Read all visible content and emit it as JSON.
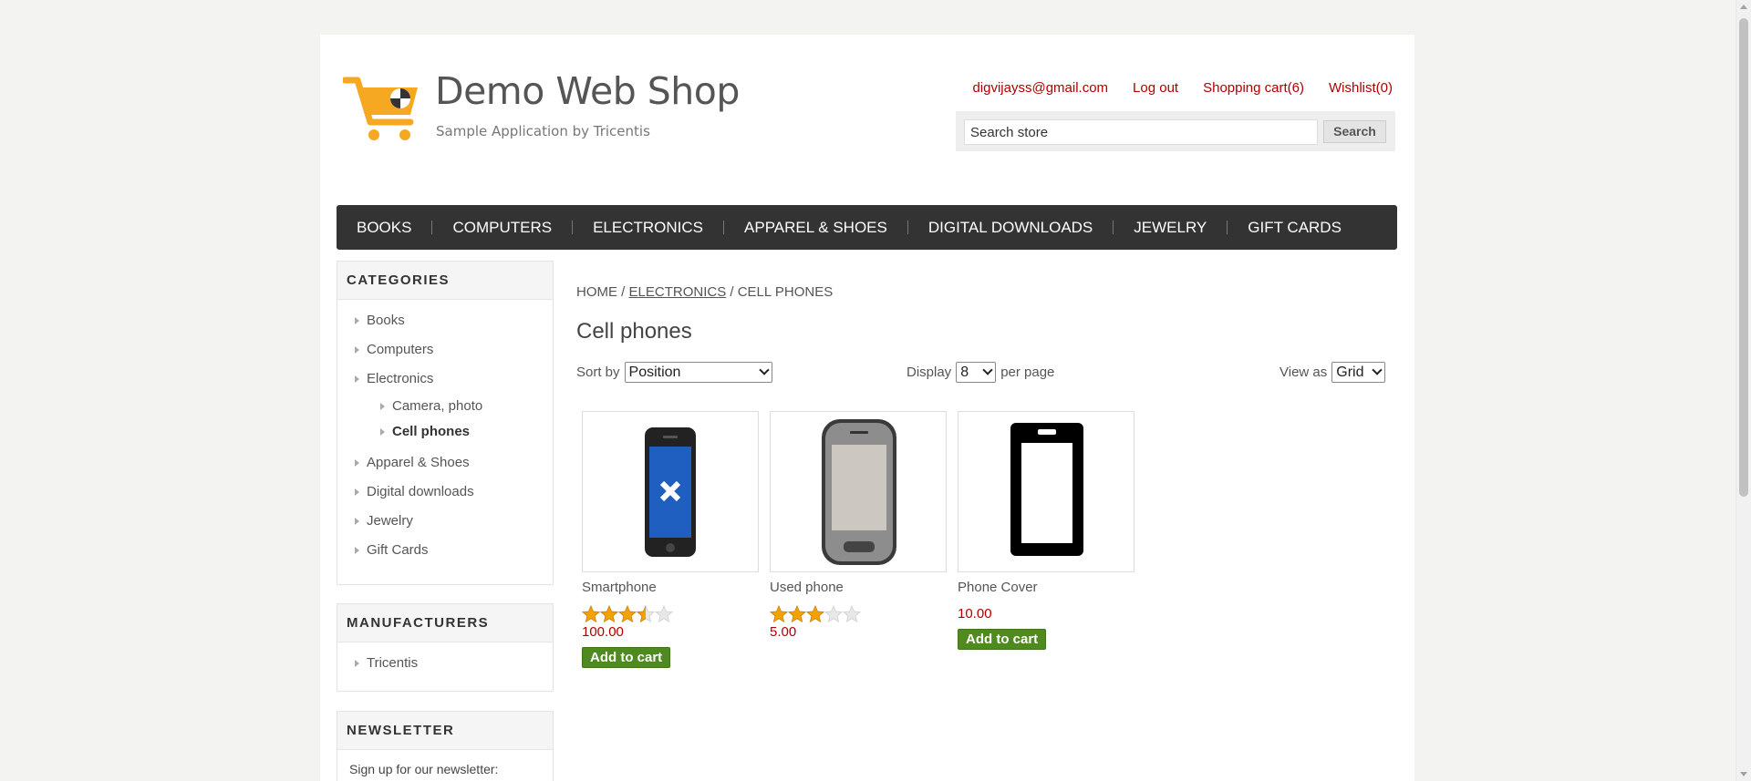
{
  "header": {
    "logo_title": "Demo Web Shop",
    "logo_subtitle": "Sample Application by Tricentis",
    "links": {
      "account": "digvijayss@gmail.com",
      "logout": "Log out",
      "cart": "Shopping cart(6)",
      "wishlist": "Wishlist(0)"
    },
    "search": {
      "value": "Search store",
      "button": "Search"
    }
  },
  "topmenu": [
    "BOOKS",
    "COMPUTERS",
    "ELECTRONICS",
    "APPAREL & SHOES",
    "DIGITAL DOWNLOADS",
    "JEWELRY",
    "GIFT CARDS"
  ],
  "categories": {
    "title": "CATEGORIES",
    "items": [
      {
        "label": "Books",
        "level": 1
      },
      {
        "label": "Computers",
        "level": 1
      },
      {
        "label": "Electronics",
        "level": 1
      },
      {
        "label": "Camera, photo",
        "level": 2
      },
      {
        "label": "Cell phones",
        "level": 2,
        "active": true
      },
      {
        "label": "Apparel & Shoes",
        "level": 1
      },
      {
        "label": "Digital downloads",
        "level": 1
      },
      {
        "label": "Jewelry",
        "level": 1
      },
      {
        "label": "Gift Cards",
        "level": 1
      }
    ]
  },
  "manufacturers": {
    "title": "MANUFACTURERS",
    "items": [
      "Tricentis"
    ]
  },
  "newsletter": {
    "title": "NEWSLETTER",
    "text": "Sign up for our newsletter:"
  },
  "breadcrumb": {
    "home": "HOME",
    "sep": "/",
    "electronics": "ELECTRONICS",
    "current": "CELL PHONES"
  },
  "page_title": "Cell phones",
  "sorting": {
    "sort_label": "Sort by",
    "sort_value": "Position",
    "display_label": "Display",
    "display_value": "8",
    "per_page": "per page",
    "view_label": "View as",
    "view_value": "Grid"
  },
  "products": [
    {
      "name": "Smartphone",
      "rating": 3.5,
      "price": "100.00",
      "button": "Add to cart"
    },
    {
      "name": "Used phone",
      "rating": 3,
      "price": "5.00",
      "button": null
    },
    {
      "name": "Phone Cover",
      "rating": null,
      "price": "10.00",
      "button": "Add to cart"
    }
  ],
  "colors": {
    "link_red": "#b00000",
    "menu_bg": "#333333",
    "button_green": "#4e8a1f",
    "star_gold": "#f5a200"
  }
}
